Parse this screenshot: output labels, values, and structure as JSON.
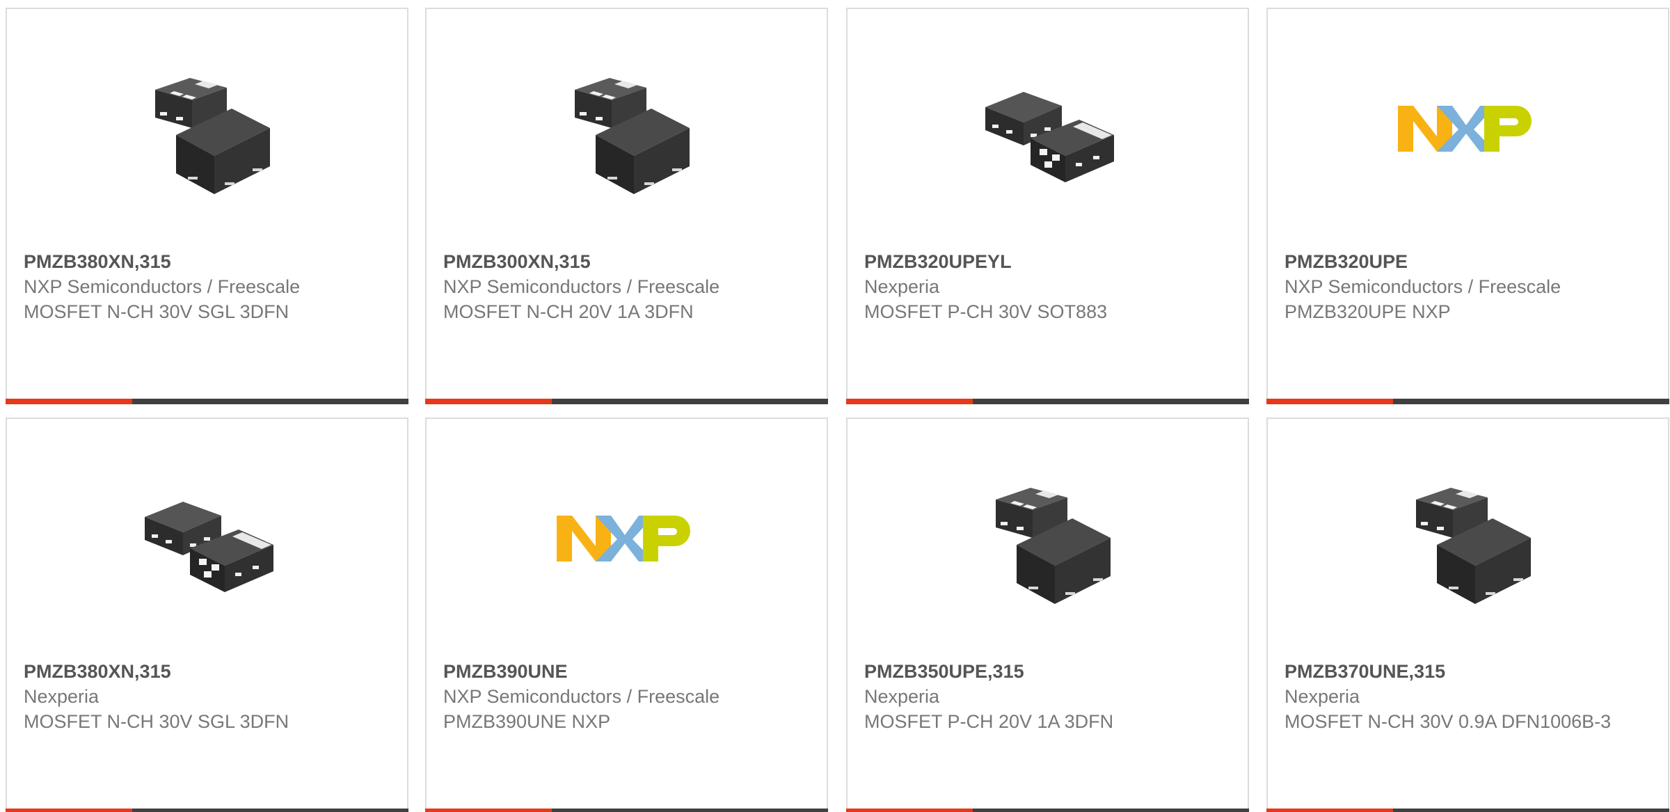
{
  "products": [
    {
      "part": "PMZB380XN,315",
      "manufacturer": "NXP Semiconductors / Freescale",
      "description": "MOSFET N-CH 30V SGL 3DFN",
      "image": "chip-package-icon",
      "image_variant": "stacked"
    },
    {
      "part": "PMZB300XN,315",
      "manufacturer": "NXP Semiconductors / Freescale",
      "description": "MOSFET N-CH 20V 1A 3DFN",
      "image": "chip-package-icon",
      "image_variant": "stacked"
    },
    {
      "part": "PMZB320UPEYL",
      "manufacturer": "Nexperia",
      "description": "MOSFET P-CH 30V SOT883",
      "image": "chip-package-icon",
      "image_variant": "side-by-side"
    },
    {
      "part": "PMZB320UPE",
      "manufacturer": "NXP Semiconductors / Freescale",
      "description": "PMZB320UPE NXP",
      "image": "nxp-logo"
    },
    {
      "part": "PMZB380XN,315",
      "manufacturer": "Nexperia",
      "description": "MOSFET N-CH 30V SGL 3DFN",
      "image": "chip-package-icon",
      "image_variant": "side-by-side"
    },
    {
      "part": "PMZB390UNE",
      "manufacturer": "NXP Semiconductors / Freescale",
      "description": "PMZB390UNE NXP",
      "image": "nxp-logo"
    },
    {
      "part": "PMZB350UPE,315",
      "manufacturer": "Nexperia",
      "description": "MOSFET P-CH 20V 1A 3DFN",
      "image": "chip-package-icon",
      "image_variant": "stacked"
    },
    {
      "part": "PMZB370UNE,315",
      "manufacturer": "Nexperia",
      "description": "MOSFET N-CH 30V 0.9A DFN1006B-3",
      "image": "chip-package-icon",
      "image_variant": "stacked"
    }
  ],
  "colors": {
    "accent": "#e8381a",
    "bar": "#404040",
    "border": "#dcdcdc",
    "part_text": "#555555",
    "body_text": "#777777",
    "nxp_n": "#f9b214",
    "nxp_x": "#7bb1db",
    "nxp_p": "#c9d200"
  }
}
